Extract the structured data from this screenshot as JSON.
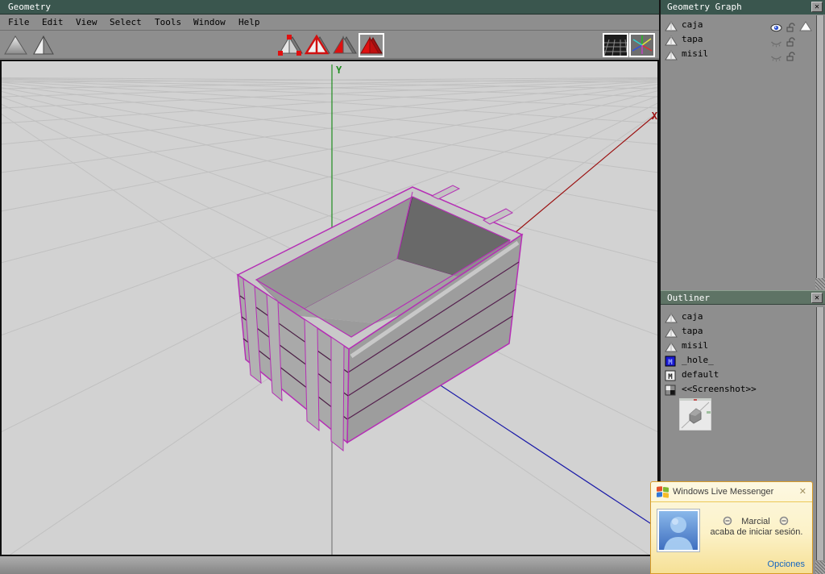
{
  "window": {
    "title": "Geometry"
  },
  "menubar": {
    "items": [
      "File",
      "Edit",
      "View",
      "Select",
      "Tools",
      "Window",
      "Help"
    ],
    "f1": "File",
    "f2": "Edit",
    "f3": "View",
    "f4": "Select",
    "f5": "Tools",
    "f6": "Window",
    "f7": "Help"
  },
  "toolbar": {
    "left_icons": [
      {
        "name": "smooth-shaded-pyramid"
      },
      {
        "name": "flat-shaded-pyramid"
      }
    ],
    "select_modes": [
      {
        "name": "vertex"
      },
      {
        "name": "edge"
      },
      {
        "name": "face"
      },
      {
        "name": "body",
        "selected": true
      }
    ],
    "view_toggles": [
      {
        "name": "show-ground-plane",
        "active": true
      },
      {
        "name": "show-axes",
        "active": true
      }
    ]
  },
  "viewport": {
    "axis_x_label": "X",
    "axis_y_label": "Y",
    "colors": {
      "background": "#d2d2d2",
      "grid": "#c0c0c0",
      "x_axis": "#9b1111",
      "y_axis": "#1f8c1f",
      "z_axis": "#1a1aa8",
      "selection_edge": "#b52fb5"
    }
  },
  "geometry_graph": {
    "title": "Geometry Graph",
    "items": [
      {
        "label": "caja",
        "eye": "open",
        "lock": "unlocked",
        "selected": true
      },
      {
        "label": "tapa",
        "eye": "closed",
        "lock": "unlocked",
        "selected": false
      },
      {
        "label": "misil",
        "eye": "closed",
        "lock": "unlocked",
        "selected": false
      }
    ]
  },
  "outliner": {
    "title": "Outliner",
    "items": [
      {
        "label": "caja",
        "icon": "object-triangle"
      },
      {
        "label": "tapa",
        "icon": "object-triangle"
      },
      {
        "label": "misil",
        "icon": "object-triangle"
      },
      {
        "label": "_hole_",
        "icon": "material-hole"
      },
      {
        "label": "default",
        "icon": "material"
      },
      {
        "label": "<<Screenshot>>",
        "icon": "image-checker"
      }
    ]
  },
  "messenger": {
    "title": "Windows Live Messenger",
    "contact_name": "Marcial",
    "status_message": "acaba de iniciar sesión.",
    "options_label": "Opciones",
    "accent_border": "#d89c28",
    "link_color": "#1565c0"
  }
}
